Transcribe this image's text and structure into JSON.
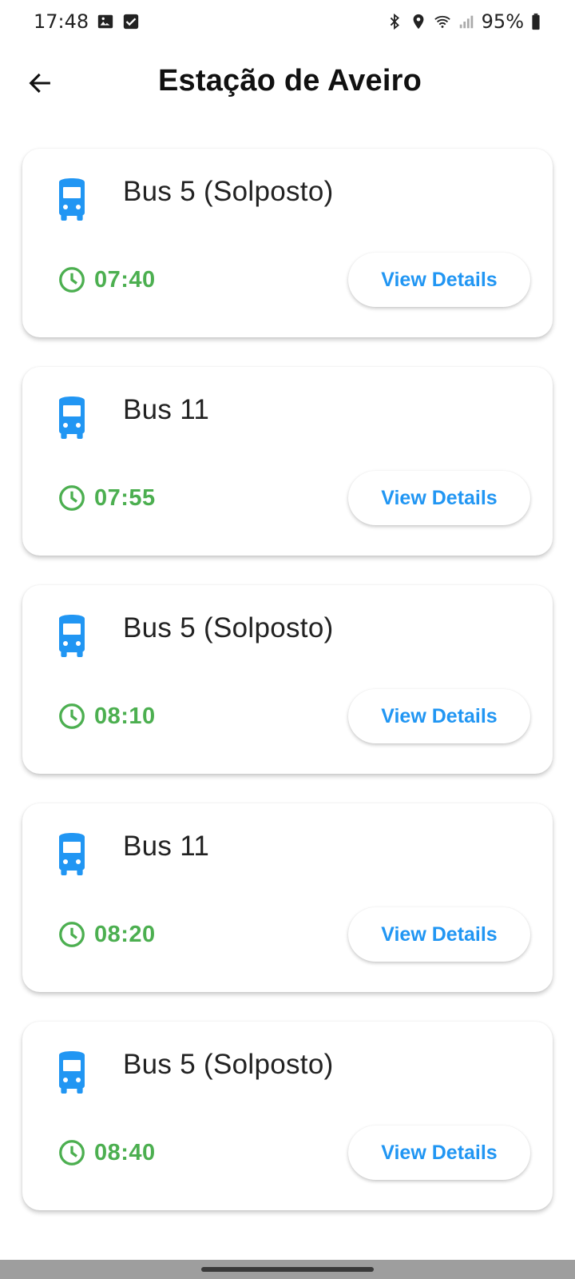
{
  "status_bar": {
    "time": "17:48",
    "left_icons": [
      "gallery-icon",
      "checkbox-icon"
    ],
    "right_icons": [
      "bluetooth-icon",
      "location-icon",
      "wifi-icon",
      "signal-icon",
      "battery-icon"
    ],
    "battery": "95%"
  },
  "header": {
    "title": "Estação de Aveiro",
    "back_icon": "arrow-back-icon"
  },
  "colors": {
    "accent_blue": "#2196f3",
    "time_green": "#4caf50"
  },
  "departures": [
    {
      "route": "Bus 5 (Solposto)",
      "time": "07:40",
      "button": "View Details"
    },
    {
      "route": "Bus 11",
      "time": "07:55",
      "button": "View Details"
    },
    {
      "route": "Bus 5 (Solposto)",
      "time": "08:10",
      "button": "View Details"
    },
    {
      "route": "Bus 11",
      "time": "08:20",
      "button": "View Details"
    },
    {
      "route": "Bus 5 (Solposto)",
      "time": "08:40",
      "button": "View Details"
    }
  ]
}
